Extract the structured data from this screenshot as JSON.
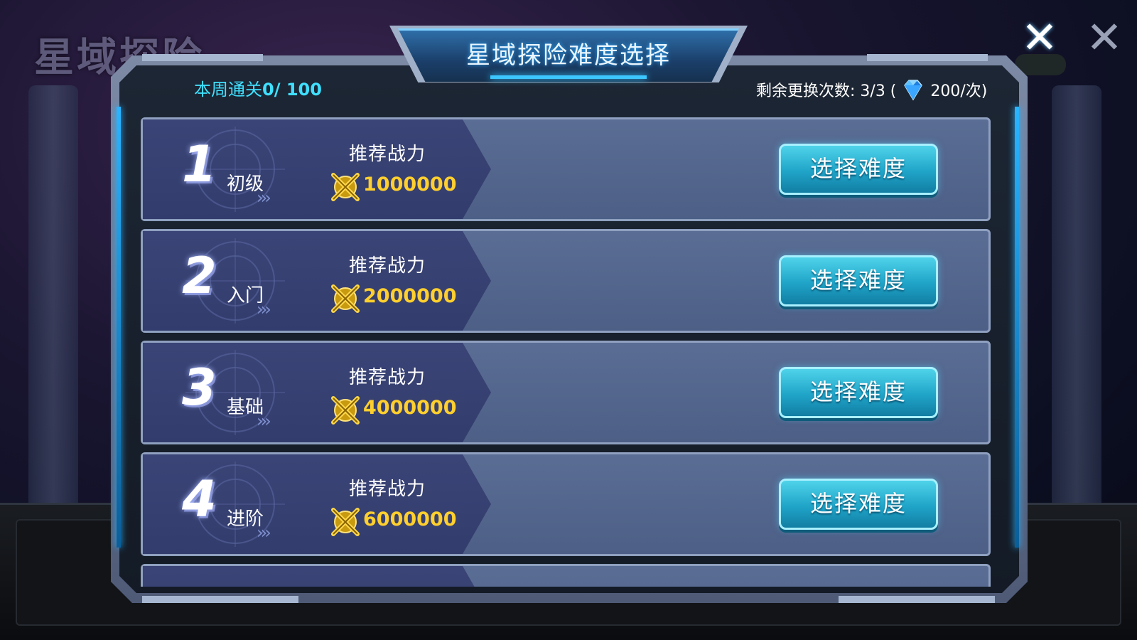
{
  "background": {
    "watermark_title": "星域探险"
  },
  "top_controls": {
    "close_primary": "✕",
    "close_secondary": "✕"
  },
  "dialog": {
    "title": "星域探险难度选择",
    "weekly_clear_label": "本周通关",
    "weekly_clear_value": "0/ 100",
    "changes_label": "剩余更换次数: 3/3 (",
    "changes_cost": "200/次)",
    "rows": [
      {
        "number": "1",
        "level": "初级",
        "rec_label": "推荐战力",
        "power": "1000000",
        "button": "选择难度"
      },
      {
        "number": "2",
        "level": "入门",
        "rec_label": "推荐战力",
        "power": "2000000",
        "button": "选择难度"
      },
      {
        "number": "3",
        "level": "基础",
        "rec_label": "推荐战力",
        "power": "4000000",
        "button": "选择难度"
      },
      {
        "number": "4",
        "level": "进阶",
        "rec_label": "推荐战力",
        "power": "6000000",
        "button": "选择难度"
      }
    ]
  },
  "colors": {
    "accent_cyan": "#3fe0ff",
    "power_gold": "#ffcf2e",
    "button_teal": "#1fa4c8"
  },
  "icons": {
    "gem": "blue-diamond-icon",
    "power": "crossed-swords-power-icon",
    "close": "close-icon"
  }
}
